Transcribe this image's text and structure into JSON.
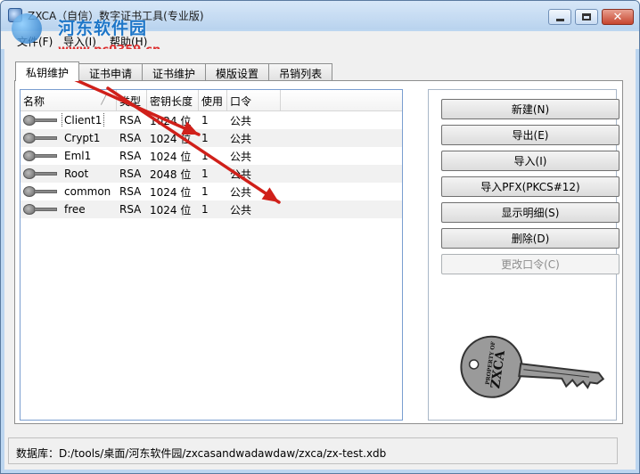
{
  "window": {
    "title": "ZXCA（自信）数字证书工具(专业版)",
    "close_glyph": "✕"
  },
  "watermark": {
    "title": "河东软件园",
    "url": "www.pc0359.cn"
  },
  "menu": {
    "items": [
      {
        "label": "文件(F)"
      },
      {
        "label": "导入(I)"
      },
      {
        "label": "帮助(H)"
      }
    ]
  },
  "tabs": [
    {
      "label": "私钥维护",
      "active": true
    },
    {
      "label": "证书申请",
      "active": false
    },
    {
      "label": "证书维护",
      "active": false
    },
    {
      "label": "模版设置",
      "active": false
    },
    {
      "label": "吊销列表",
      "active": false
    }
  ],
  "list": {
    "columns": [
      "名称",
      "类型",
      "密钥长度",
      "使用",
      "口令"
    ],
    "rows": [
      {
        "name": "Client1",
        "type": "RSA",
        "length": "1024 位",
        "use": "1",
        "password": "公共"
      },
      {
        "name": "Crypt1",
        "type": "RSA",
        "length": "1024 位",
        "use": "1",
        "password": "公共"
      },
      {
        "name": "Eml1",
        "type": "RSA",
        "length": "1024 位",
        "use": "1",
        "password": "公共"
      },
      {
        "name": "Root",
        "type": "RSA",
        "length": "2048 位",
        "use": "1",
        "password": "公共"
      },
      {
        "name": "common",
        "type": "RSA",
        "length": "1024 位",
        "use": "1",
        "password": "公共"
      },
      {
        "name": "free",
        "type": "RSA",
        "length": "1024 位",
        "use": "1",
        "password": "公共"
      }
    ]
  },
  "actions": {
    "new": "新建(N)",
    "export": "导出(E)",
    "import": "导入(I)",
    "import_pfx": "导入PFX(PKCS#12)",
    "show_detail": "显示明细(S)",
    "delete": "删除(D)",
    "change_password": "更改口令(C)"
  },
  "key_art": {
    "line1": "PROPERTY OF",
    "line2": "ZXCA"
  },
  "status": {
    "text": "数据库：D:/tools/桌面/河东软件园/zxcasandwadawdaw/zxca/zx-test.xdb"
  },
  "colors": {
    "arrow": "#d0201a",
    "title_bg": "#bcd6f0",
    "list_border": "#7a9ed0"
  }
}
